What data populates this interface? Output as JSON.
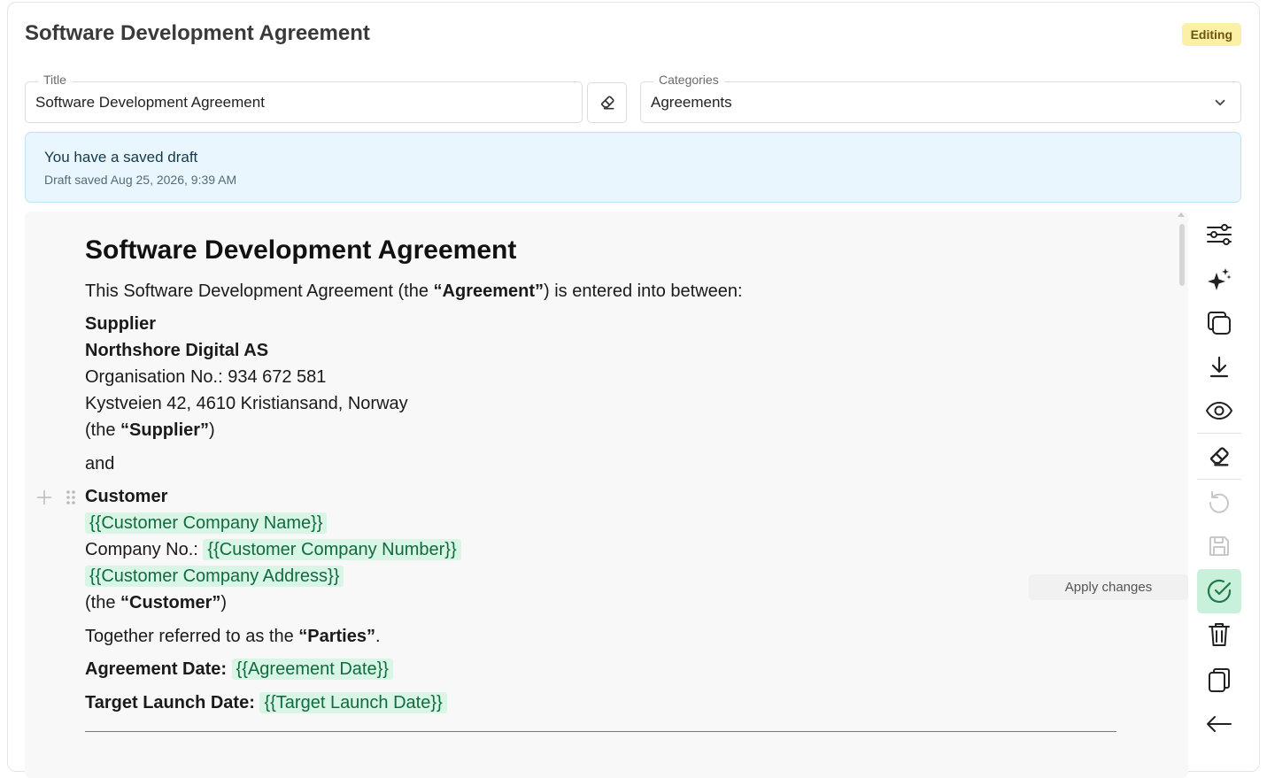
{
  "header": {
    "title": "Software Development Agreement",
    "status_badge": "Editing"
  },
  "form": {
    "title_label": "Title",
    "title_value": "Software Development Agreement",
    "categories_label": "Categories",
    "categories_value": "Agreements"
  },
  "draft_notice": {
    "title": "You have a saved draft",
    "subtitle": "Draft saved Aug 25, 2026, 9:39 AM"
  },
  "document": {
    "heading": "Software Development Agreement",
    "intro_prefix": "This Software Development Agreement (the ",
    "intro_term": "“Agreement”",
    "intro_suffix": ") is entered into between:",
    "supplier_label": "Supplier",
    "supplier_name": "Northshore Digital AS",
    "supplier_org": "Organisation No.: 934 672 581",
    "supplier_address": "Kystveien 42, 4610 Kristiansand, Norway",
    "supplier_def_prefix": "(the ",
    "supplier_def_term": "“Supplier”",
    "supplier_def_suffix": ")",
    "and_text": "and",
    "customer_label": "Customer",
    "customer_name_var": "{{Customer Company Name}}",
    "company_no_prefix": "Company No.: ",
    "customer_number_var": "{{Customer Company Number}}",
    "customer_address_var": "{{Customer Company Address}}",
    "customer_def_prefix": "(the ",
    "customer_def_term": "“Customer”",
    "customer_def_suffix": ")",
    "parties_prefix": "Together referred to as the ",
    "parties_term": "“Parties”",
    "parties_suffix": ".",
    "agreement_date_label": "Agreement Date:",
    "agreement_date_var": "{{Agreement Date}}",
    "launch_date_label": "Target Launch Date:",
    "launch_date_var": "{{Target Launch Date}}"
  },
  "toolbar": {
    "apply_tooltip": "Apply changes",
    "icons": [
      "settings-sliders-icon",
      "ai-sparkle-icon",
      "duplicate-icon",
      "download-icon",
      "preview-eye-icon",
      "eraser-icon",
      "revert-icon",
      "save-icon",
      "apply-check-icon",
      "delete-trash-icon",
      "copy-icon",
      "back-arrow-icon"
    ]
  },
  "colors": {
    "badge_bg": "#fbf0a6",
    "variable_bg": "#d8f5e6",
    "variable_text": "#126a3e",
    "draft_bg": "#eaf6fd",
    "apply_active_bg": "#c9f0da"
  }
}
